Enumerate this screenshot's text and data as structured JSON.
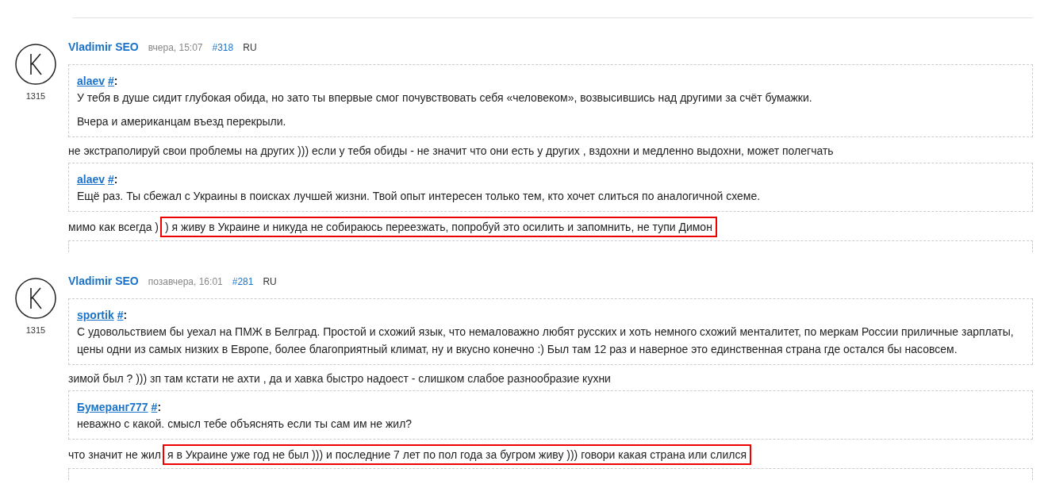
{
  "posts": [
    {
      "author": "Vladimir SEO",
      "time": "вчера, 15:07",
      "number": "#318",
      "lang": "RU",
      "rating": "1315",
      "blocks": [
        {
          "kind": "quote",
          "user": "alaev",
          "anchor": "#",
          "colon": ":",
          "paragraphs": [
            "У тебя в душе сидит глубокая обида, но зато ты впервые смог почувствовать себя «человеком», возвысившись над другими за счёт бумажки.",
            "Вчера и американцам въезд перекрыли."
          ]
        },
        {
          "kind": "reply",
          "text": "не экстраполируй свои проблемы на других ))) если у тебя обиды - не значит что они есть у других , вздохни и медленно выдохни, может полегчать"
        },
        {
          "kind": "quote",
          "user": "alaev",
          "anchor": "#",
          "colon": ":",
          "paragraphs": [
            "Ещё раз. Ты сбежал с Украины в поисках лучшей жизни. Твой опыт интересен только тем, кто хочет слиться по аналогичной схеме."
          ]
        },
        {
          "kind": "reply",
          "text": "мимо как всегда )",
          "highlight": ") я живу в Украине и никуда не собираюсь переезжать, попробуй это осилить и запомнить, не тупи Димон"
        },
        {
          "kind": "clipped"
        }
      ]
    },
    {
      "author": "Vladimir SEO",
      "time": "позавчера, 16:01",
      "number": "#281",
      "lang": "RU",
      "rating": "1315",
      "blocks": [
        {
          "kind": "quote",
          "user": "sportik",
          "anchor": "#",
          "colon": ":",
          "paragraphs": [
            "С удовольствием бы уехал на ПМЖ в Белград. Простой и схожий язык, что немаловажно любят русских и хоть немного схожий менталитет, по меркам России приличные зарплаты, цены одни из самых низких в Европе, более благоприятный климат, ну и вкусно конечно :) Был там 12 раз и наверное это единственная страна где остался бы насовсем."
          ]
        },
        {
          "kind": "reply",
          "text": "зимой был ? ))) зп там кстати не ахти , да и хавка быстро надоест - слишком слабое разнообразие кухни"
        },
        {
          "kind": "quote",
          "user": "Бумеранг777",
          "anchor": "#",
          "colon": ":",
          "paragraphs": [
            "неважно с какой. смысл тебе объяснять если ты сам им не жил?"
          ]
        },
        {
          "kind": "reply",
          "text": "что значит не жил",
          "highlight": "я в Украине уже год не был ))) и последние 7 лет по пол года за бугром живу ))) говори какая страна или слился"
        },
        {
          "kind": "clipped"
        }
      ]
    }
  ]
}
